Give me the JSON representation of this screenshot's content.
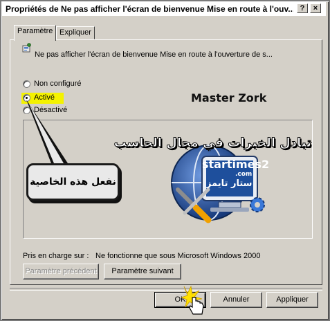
{
  "window": {
    "title": "Propriétés de Ne pas afficher l'écran de bienvenue Mise en route à l'ouv...",
    "help_label": "?",
    "close_label": "×"
  },
  "tabs": [
    {
      "label": "Paramètre",
      "active": true
    },
    {
      "label": "Expliquer",
      "active": false
    }
  ],
  "policy": {
    "icon": "policy-setting-icon",
    "name": "Ne pas afficher l'écran de bienvenue Mise en route à l'ouverture de s..."
  },
  "options": [
    {
      "label": "Non configuré",
      "checked": false
    },
    {
      "label": "Activé",
      "checked": true
    },
    {
      "label": "Désactivé",
      "checked": false
    }
  ],
  "annotation": {
    "author": "Master Zork",
    "callout_text": "نفعل هذه الخاصية",
    "highlight_color": "#f4f200"
  },
  "logo": {
    "tagline_ar": "تبادل الخبرات في مجال الحاسب",
    "brand": "startimes2",
    "domain": ".com",
    "brand_ar": "ستار تايمز"
  },
  "support": {
    "label": "Pris en charge sur :",
    "value": "Ne fonctionne que sous Microsoft Windows 2000"
  },
  "nav_buttons": {
    "previous": "Paramètre précédent",
    "next": "Paramètre suivant"
  },
  "dialog_buttons": {
    "ok": "OK",
    "cancel": "Annuler",
    "apply": "Appliquer"
  },
  "colors": {
    "dialog_bg": "#d4d0c8",
    "globe_blue": "#1f4f9c",
    "tool_orange": "#f0a000"
  }
}
